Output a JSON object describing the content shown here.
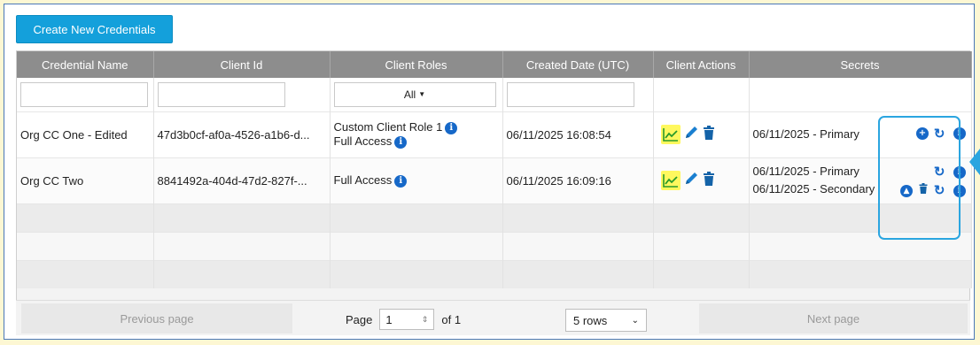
{
  "toolbar": {
    "create_label": "Create New Credentials"
  },
  "columns": [
    "Credential Name",
    "Client Id",
    "Client Roles",
    "Created Date (UTC)",
    "Client Actions",
    "Secrets"
  ],
  "filters": {
    "roles_select": "All"
  },
  "rows": [
    {
      "name": "Org CC One - Edited",
      "client_id": "47d3b0cf-af0a-4526-a1b6-d...",
      "roles": [
        "Custom Client Role 1",
        "Full Access"
      ],
      "created": "06/11/2025 16:08:54",
      "secrets": [
        "06/11/2025 - Primary"
      ]
    },
    {
      "name": "Org CC Two",
      "client_id": "8841492a-404d-47d2-827f-...",
      "roles": [
        "Full Access"
      ],
      "created": "06/11/2025 16:09:16",
      "secrets": [
        "06/11/2025 - Primary",
        "06/11/2025 - Secondary"
      ]
    }
  ],
  "pagination": {
    "prev_label": "Previous page",
    "next_label": "Next page",
    "page_label": "Page",
    "page_value": "1",
    "of_label": "of 1",
    "rows_option": "5 rows"
  },
  "colors": {
    "accent": "#14a0db",
    "header": "#8d8d8d",
    "info": "#1668c8",
    "highlight": "#fff85e",
    "annotation": "#2aa5e0"
  }
}
